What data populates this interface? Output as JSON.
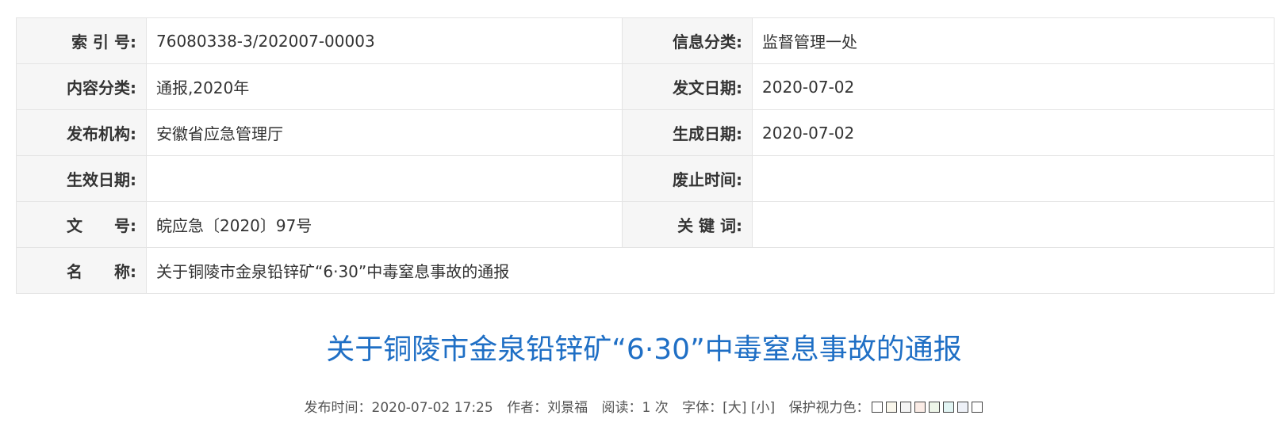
{
  "meta": {
    "rows": [
      {
        "l1": "索 引 号:",
        "v1": "76080338-3/202007-00003",
        "l2": "信息分类:",
        "v2": "监督管理一处"
      },
      {
        "l1": "内容分类:",
        "v1": "通报,2020年",
        "l2": "发文日期:",
        "v2": "2020-07-02"
      },
      {
        "l1": "发布机构:",
        "v1": "安徽省应急管理厅",
        "l2": "生成日期:",
        "v2": "2020-07-02"
      },
      {
        "l1": "生效日期:",
        "v1": "",
        "l2": "废止时间:",
        "v2": ""
      },
      {
        "l1": "文　　号:",
        "v1": "皖应急〔2020〕97号",
        "l2": "关 键 词:",
        "v2": ""
      }
    ],
    "name_label": "名　　称:",
    "name_value": "关于铜陵市金泉铅锌矿“6·30”中毒窒息事故的通报"
  },
  "article": {
    "title": "关于铜陵市金泉铅锌矿“6·30”中毒窒息事故的通报"
  },
  "info": {
    "publish": "发布时间：2020-07-02 17:25",
    "author": "作者：刘景福",
    "reads": "阅读：1 次",
    "font_label": "字体：",
    "font_large": "[大]",
    "font_small": "[小]",
    "eye_label": "保护视力色：",
    "swatches": [
      "#ffffff",
      "#faf7ec",
      "#f4f4f4",
      "#fbece6",
      "#eef6e9",
      "#e2f5f4",
      "#eef1f8",
      "#ffffff"
    ]
  }
}
